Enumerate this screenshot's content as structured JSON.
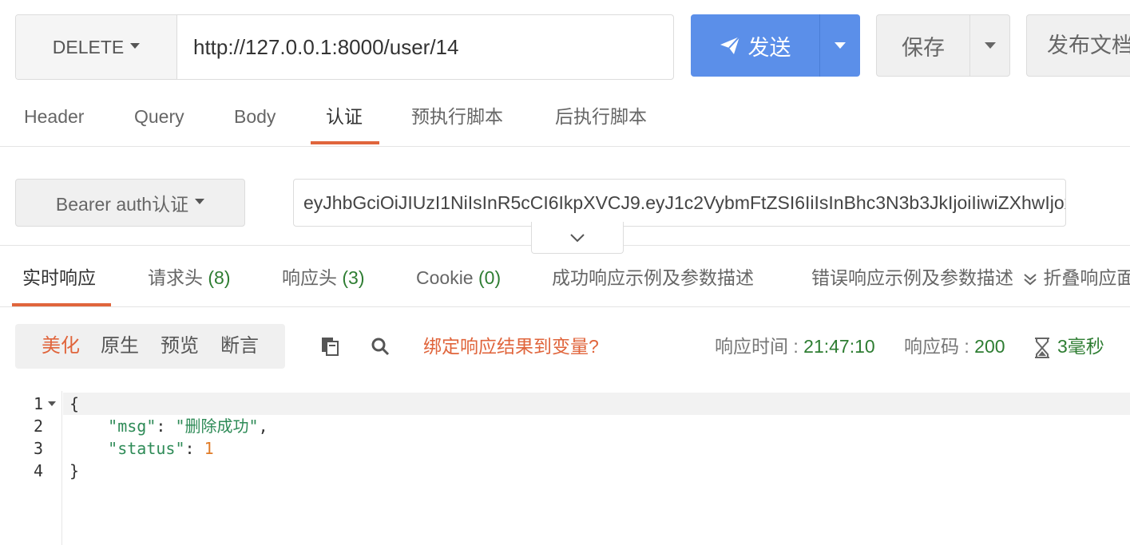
{
  "request": {
    "method": "DELETE",
    "url": "http://127.0.0.1:8000/user/14",
    "send_label": "发送",
    "save_label": "保存",
    "publish_label": "发布文档"
  },
  "request_tabs": [
    "Header",
    "Query",
    "Body",
    "认证",
    "预执行脚本",
    "后执行脚本"
  ],
  "active_request_tab": "认证",
  "auth": {
    "type": "Bearer auth认证",
    "token": "eyJhbGciOiJIUzI1NiIsInR5cCI6IkpXVCJ9.eyJ1c2VybmFtZSI6IiIsInBhc3N3b3JkIjoiIiwiZXhwIjoxNjU"
  },
  "response_tabs": [
    {
      "label": "实时响应",
      "count": ""
    },
    {
      "label": "请求头",
      "count": "(8)"
    },
    {
      "label": "响应头",
      "count": "(3)"
    },
    {
      "label": "Cookie",
      "count": "(0)"
    },
    {
      "label": "成功响应示例及参数描述",
      "count": ""
    },
    {
      "label": "错误响应示例及参数描述",
      "count": ""
    }
  ],
  "collapse_label": "折叠响应面板",
  "format_tabs": [
    "美化",
    "原生",
    "预览",
    "断言"
  ],
  "active_format_tab": "美化",
  "bind_label": "绑定响应结果到变量?",
  "response_meta": {
    "time_label": "响应时间 : ",
    "time_value": "21:47:10",
    "code_label": "响应码 : ",
    "code_value": "200",
    "duration": "3毫秒"
  },
  "code_lines": [
    {
      "no": "1",
      "text": "{"
    },
    {
      "no": "2",
      "key": "\"msg\"",
      "value": "\"删除成功\"",
      "trail": ","
    },
    {
      "no": "3",
      "key": "\"status\"",
      "value": "1",
      "trail": ""
    },
    {
      "no": "4",
      "text": "}"
    }
  ],
  "colors": {
    "accent": "#e0653c",
    "primary": "#5b8fe9",
    "success": "#2e7d32"
  }
}
